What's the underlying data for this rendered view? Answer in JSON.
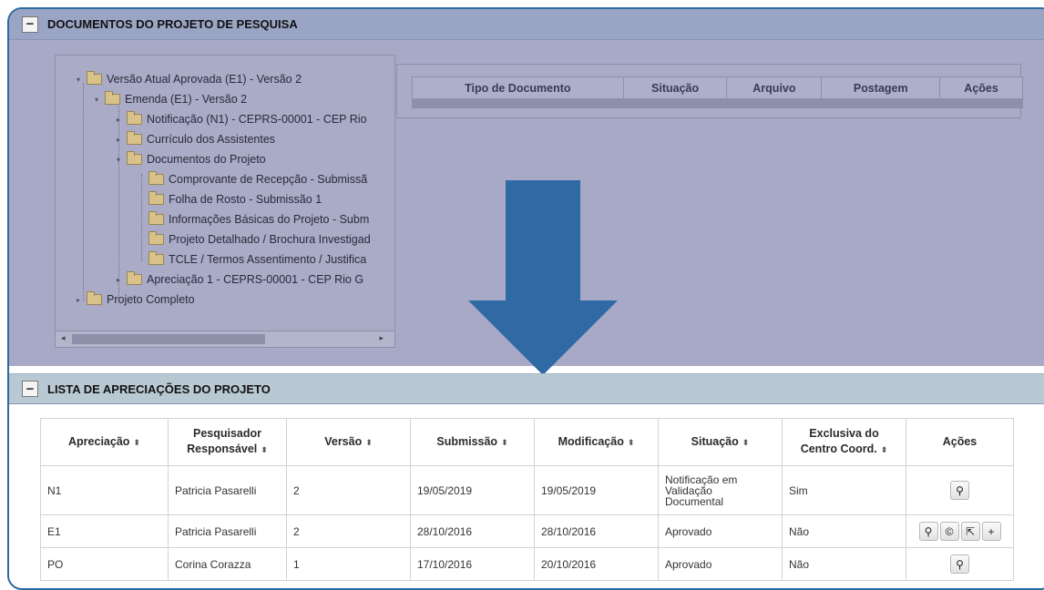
{
  "documents_panel": {
    "title": "DOCUMENTOS DO PROJETO DE PESQUISA",
    "collapse_symbol": "−",
    "tree": [
      {
        "label": "Versão Atual Aprovada (E1) - Versão 2",
        "expander": "▾"
      },
      {
        "label": "Emenda (E1) - Versão 2",
        "expander": "▾"
      },
      {
        "label": "Notificação (N1) - CEPRS-00001 - CEP Rio",
        "expander": "▸"
      },
      {
        "label": "Currículo dos Assistentes",
        "expander": "▸"
      },
      {
        "label": "Documentos do Projeto",
        "expander": "▾"
      },
      {
        "label": "Comprovante de Recepção - Submissã",
        "expander": ""
      },
      {
        "label": "Folha de Rosto - Submissão 1",
        "expander": ""
      },
      {
        "label": "Informações Básicas do Projeto - Subm",
        "expander": ""
      },
      {
        "label": "Projeto Detalhado / Brochura Investigad",
        "expander": ""
      },
      {
        "label": "TCLE / Termos Assentimento / Justifica",
        "expander": ""
      },
      {
        "label": "Apreciação 1 - CEPRS-00001 - CEP Rio G",
        "expander": "▸"
      },
      {
        "label": "Projeto Completo",
        "expander": "▸"
      }
    ],
    "scroll_left": "◂",
    "scroll_right": "▸",
    "doc_table_headers": [
      "Tipo de Documento",
      "Situação",
      "Arquivo",
      "Postagem",
      "Ações"
    ]
  },
  "appraisals_panel": {
    "title": "LISTA DE APRECIAÇÕES DO PROJETO",
    "collapse_symbol": "−",
    "sort_icon": "⬍",
    "headers": [
      {
        "line1": "Apreciação",
        "line2": ""
      },
      {
        "line1": "Pesquisador",
        "line2": "Responsável"
      },
      {
        "line1": "Versão",
        "line2": ""
      },
      {
        "line1": "Submissão",
        "line2": ""
      },
      {
        "line1": "Modificação",
        "line2": ""
      },
      {
        "line1": "Situação",
        "line2": ""
      },
      {
        "line1": "Exclusiva do",
        "line2": "Centro Coord."
      },
      {
        "line1": "Ações",
        "line2": ""
      }
    ],
    "rows": [
      {
        "apreciacao": "N1",
        "pesquisador": "Patricia Pasarelli",
        "versao": "2",
        "submissao": "19/05/2019",
        "modificacao": "19/05/2019",
        "situacao": [
          "Notificação em",
          "Validação",
          "Documental"
        ],
        "exclusiva": "Sim",
        "acoes": [
          "search-icon"
        ]
      },
      {
        "apreciacao": "E1",
        "pesquisador": "Patricia Pasarelli",
        "versao": "2",
        "submissao": "28/10/2016",
        "modificacao": "28/10/2016",
        "situacao": [
          "Aprovado"
        ],
        "exclusiva": "Não",
        "acoes": [
          "search-icon",
          "copyright-icon",
          "external-link-icon",
          "plus-icon"
        ]
      },
      {
        "apreciacao": "PO",
        "pesquisador": "Corina Corazza",
        "versao": "1",
        "submissao": "17/10/2016",
        "modificacao": "20/10/2016",
        "situacao": [
          "Aprovado"
        ],
        "exclusiva": "Não",
        "acoes": [
          "search-icon"
        ]
      }
    ],
    "icon_glyphs": {
      "search-icon": "⚲",
      "copyright-icon": "©",
      "external-link-icon": "⇱",
      "plus-icon": "+"
    }
  },
  "colors": {
    "arrow": "#2f6aa5",
    "frame_border": "#2c6aa3"
  }
}
